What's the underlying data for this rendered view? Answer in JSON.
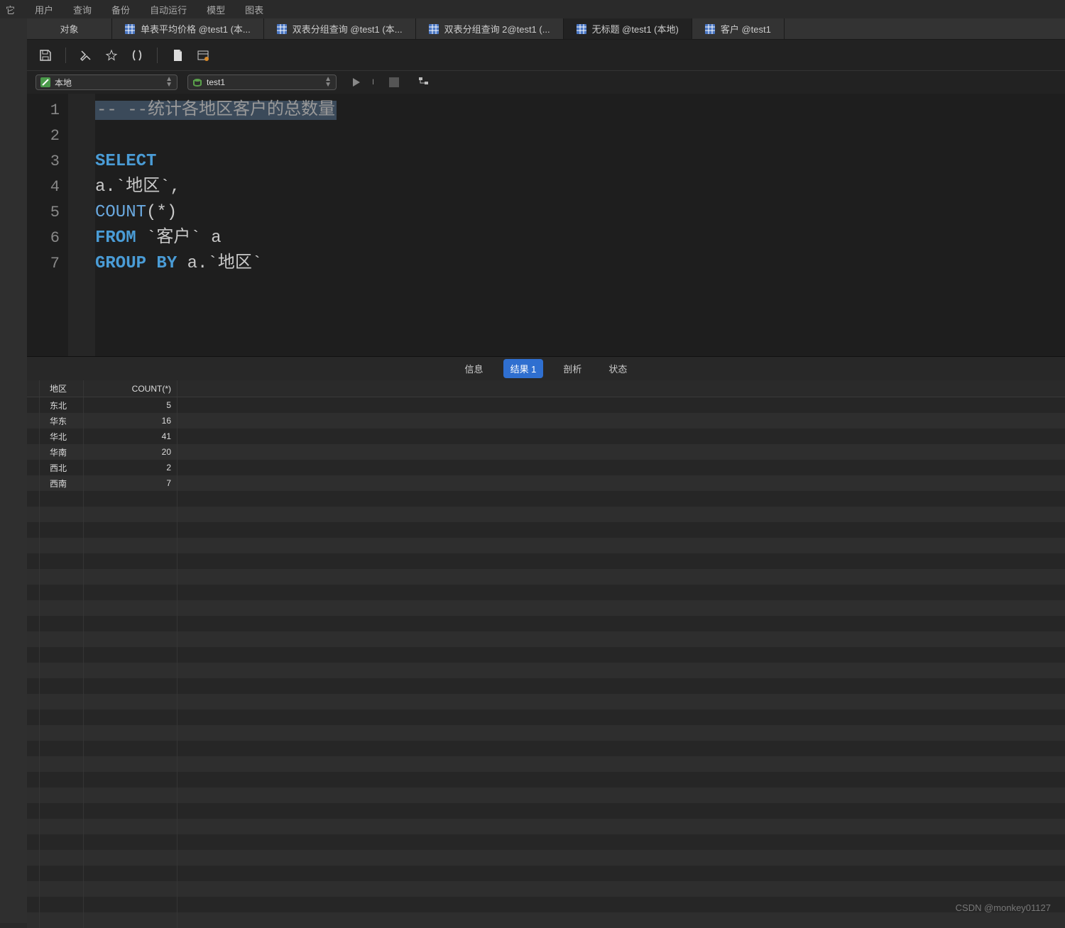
{
  "menubar": [
    "它",
    "用户",
    "查询",
    "备份",
    "自动运行",
    "模型",
    "图表"
  ],
  "tabs": [
    {
      "label": "对象",
      "icon": null,
      "active": false
    },
    {
      "label": "单表平均价格 @test1 (本...",
      "icon": "table",
      "active": false
    },
    {
      "label": "双表分组查询 @test1 (本...",
      "icon": "table",
      "active": false
    },
    {
      "label": "双表分组查询 2@test1 (...",
      "icon": "table",
      "active": false
    },
    {
      "label": "无标题 @test1 (本地)",
      "icon": "table",
      "active": true
    },
    {
      "label": "客户 @test1",
      "icon": "table",
      "active": false
    }
  ],
  "connection": {
    "host": "本地",
    "db": "test1"
  },
  "code": {
    "comment": "-- --统计各地区客户的总数量",
    "lines": [
      {
        "raw": "SELECT",
        "tokens": [
          {
            "t": "SELECT",
            "c": "kw"
          }
        ]
      },
      {
        "raw": "a.`地区`,",
        "tokens": [
          {
            "t": "a.`地区`,",
            "c": "txt"
          }
        ]
      },
      {
        "raw": "COUNT(*)",
        "tokens": [
          {
            "t": "COUNT",
            "c": "fn"
          },
          {
            "t": "(*)",
            "c": "txt"
          }
        ]
      },
      {
        "raw": "FROM `客户` a",
        "tokens": [
          {
            "t": "FROM",
            "c": "kw"
          },
          {
            "t": " `客户` a",
            "c": "txt"
          }
        ]
      },
      {
        "raw": "GROUP BY a.`地区`",
        "tokens": [
          {
            "t": "GROUP BY",
            "c": "kw"
          },
          {
            "t": " a.`地区`",
            "c": "txt"
          }
        ]
      }
    ]
  },
  "result_tabs": [
    "信息",
    "结果 1",
    "剖析",
    "状态"
  ],
  "result_active": 1,
  "grid": {
    "columns": [
      "地区",
      "COUNT(*)"
    ],
    "rows": [
      {
        "c0": "东北",
        "c1": "5"
      },
      {
        "c0": "华东",
        "c1": "16"
      },
      {
        "c0": "华北",
        "c1": "41"
      },
      {
        "c0": "华南",
        "c1": "20"
      },
      {
        "c0": "西北",
        "c1": "2"
      },
      {
        "c0": "西南",
        "c1": "7"
      }
    ]
  },
  "watermark": "CSDN @monkey01127"
}
